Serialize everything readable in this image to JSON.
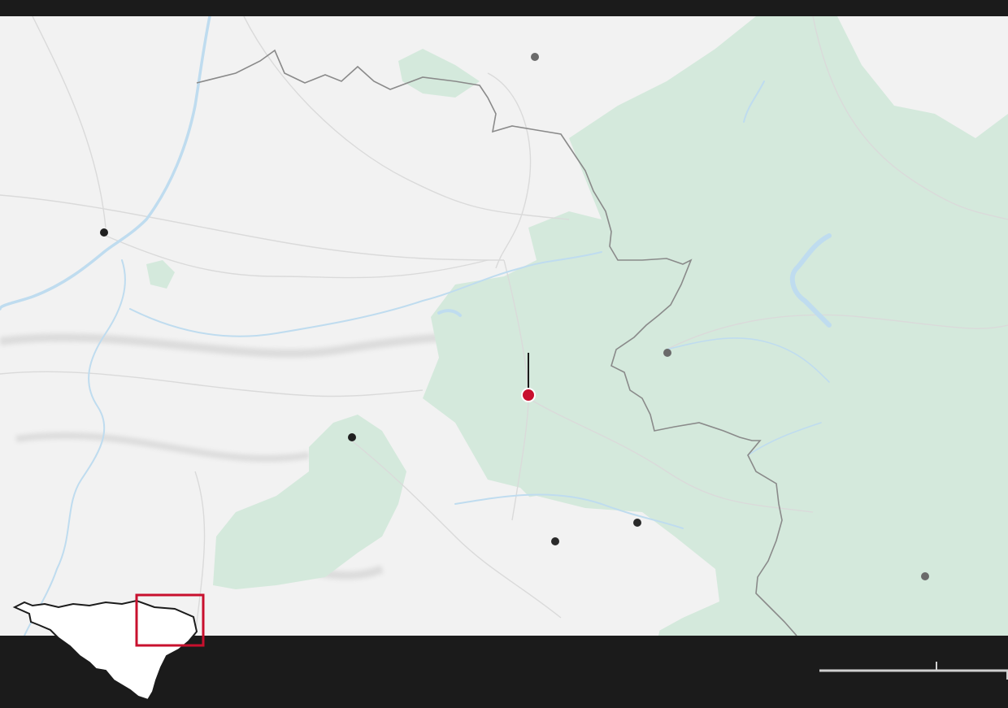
{
  "map": {
    "colors": {
      "land": "#f2f2f2",
      "forest": "#d4e9dc",
      "water": "#bfdcef",
      "roads": "#dadada",
      "border": "#8a8a8a",
      "background": "#1b1b1b",
      "accent": "#c8102e",
      "city": "#1f1f1f",
      "city_secondary": "#6a6a6a"
    },
    "marker": {
      "icon": "location-pin-icon",
      "color": "#c8102e"
    },
    "places": [
      {
        "id": "place-1",
        "kind": "city"
      },
      {
        "id": "place-2",
        "kind": "city"
      },
      {
        "id": "place-3",
        "kind": "city"
      },
      {
        "id": "place-4",
        "kind": "city"
      },
      {
        "id": "place-5",
        "kind": "secondary"
      },
      {
        "id": "place-6",
        "kind": "secondary"
      },
      {
        "id": "place-7",
        "kind": "secondary"
      }
    ],
    "locator": {
      "icon": "region-outline-icon",
      "highlight_color": "#c8102e"
    },
    "scale_bar": {
      "icon": "scale-bar-icon",
      "color": "#d0d0d0"
    }
  }
}
